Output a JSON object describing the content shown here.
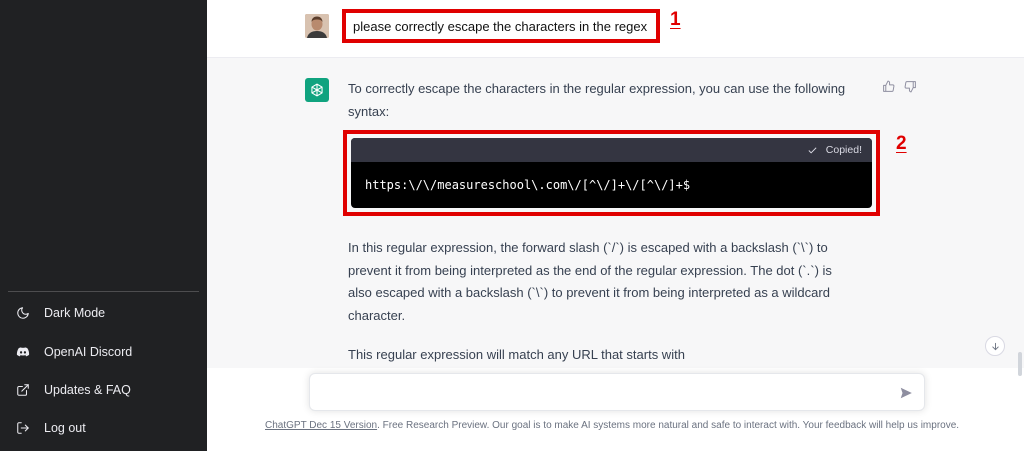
{
  "sidebar": {
    "items": [
      {
        "label": "Dark Mode",
        "icon": "moon-icon"
      },
      {
        "label": "OpenAI Discord",
        "icon": "discord-icon"
      },
      {
        "label": "Updates & FAQ",
        "icon": "external-link-icon"
      },
      {
        "label": "Log out",
        "icon": "logout-icon"
      }
    ]
  },
  "conversation": {
    "user_message": "please correctly escape the characters in the regex",
    "annotation_1": "1",
    "annotation_2": "2",
    "assistant": {
      "intro": "To correctly escape the characters in the regular expression, you can use the following syntax:",
      "code_status": "Copied!",
      "code": "https:\\/\\/measureschool\\.com\\/[^\\/]+\\/[^\\/]+$",
      "paragraph_1": "In this regular expression, the forward slash (`/`) is escaped with a backslash (`\\`) to prevent it from being interpreted as the end of the regular expression. The dot (`.`) is also escaped with a backslash (`\\`) to prevent it from being interpreted as a wildcard character.",
      "paragraph_2": "This regular expression will match any URL that starts with"
    }
  },
  "composer": {
    "placeholder": "",
    "value": ""
  },
  "footer": {
    "version_link": "ChatGPT Dec 15 Version",
    "text": ". Free Research Preview. Our goal is to make AI systems more natural and safe to interact with. Your feedback will help us improve."
  },
  "colors": {
    "sidebar_bg": "#202123",
    "accent": "#10a37f",
    "annotation": "#e00000"
  }
}
